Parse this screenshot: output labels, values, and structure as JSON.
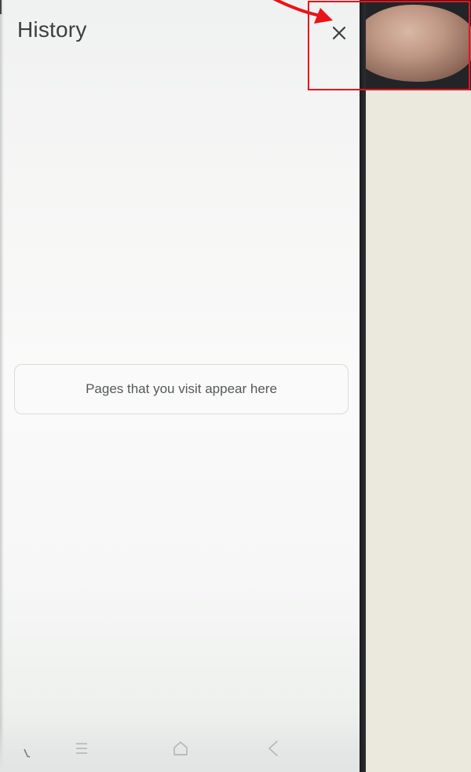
{
  "header": {
    "title": "History"
  },
  "close_button": {
    "icon": "close-icon",
    "glyph": "×"
  },
  "empty_state": {
    "message": "Pages that you visit appear here"
  },
  "nav_bar": {
    "items": [
      {
        "icon": "recent-apps-icon"
      },
      {
        "icon": "home-icon"
      },
      {
        "icon": "back-icon"
      }
    ]
  },
  "annotation": {
    "highlight_color": "#e8141b"
  }
}
